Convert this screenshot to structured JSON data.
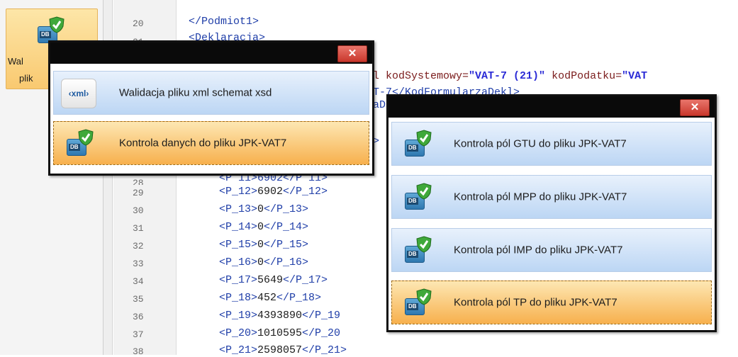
{
  "ribbon": {
    "button_line1": "Wal",
    "button_line2": "plik"
  },
  "editor": {
    "line_numbers": [
      "20",
      "21",
      "28",
      "29",
      "30",
      "31",
      "32",
      "33",
      "34",
      "35",
      "36",
      "37",
      "38"
    ],
    "lines": {
      "l20": "</Podmiot1>",
      "l21": "<Deklaracja>",
      "kod_attr": "l kodSystemowy=",
      "kod_val": "\"VAT-7 (21)\"",
      "kod_attr2": " kodPodatku=",
      "kod_val2": "\"VAT",
      "frag_a": "T-7</KodFormularzaDekl>",
      "frag_b": "aD",
      "frag_c": ">",
      "l28": "<P_11>6902</P_11>",
      "l29_open": "<P_12>",
      "l29_val": "6902",
      "l29_close": "</P_12>",
      "l30_open": "<P_13>",
      "l30_val": "0",
      "l30_close": "</P_13>",
      "l31_open": "<P_14>",
      "l31_val": "0",
      "l31_close": "</P_14>",
      "l32_open": "<P_15>",
      "l32_val": "0",
      "l32_close": "</P_15>",
      "l33_open": "<P_16>",
      "l33_val": "0",
      "l33_close": "</P_16>",
      "l34_open": "<P_17>",
      "l34_val": "5649",
      "l34_close": "</P_17>",
      "l35_open": "<P_18>",
      "l35_val": "452",
      "l35_close": "</P_18>",
      "l36_open": "<P_19>",
      "l36_val": "4393890",
      "l36_close": "</P_19",
      "l37_open": "<P_20>",
      "l37_val": "1010595",
      "l37_close": "</P_20",
      "l38_open": "<P_21>",
      "l38_val": "2598057",
      "l38_close": "</P_21>"
    }
  },
  "popup1": {
    "close_label": "✕",
    "items": [
      {
        "label": "Walidacja pliku xml schemat xsd",
        "icon": "xml-icon",
        "xml_text": "‹xml›"
      },
      {
        "label": "Kontrola danych do pliku JPK-VAT7",
        "icon": "db-check-icon",
        "db_text": "DB"
      }
    ]
  },
  "popup2": {
    "close_label": "✕",
    "items": [
      {
        "label": "Kontrola pól GTU do pliku JPK-VAT7",
        "icon": "db-check-icon",
        "db_text": "DB"
      },
      {
        "label": "Kontrola pól MPP do pliku JPK-VAT7",
        "icon": "db-check-icon",
        "db_text": "DB"
      },
      {
        "label": "Kontrola pól IMP do pliku JPK-VAT7",
        "icon": "db-check-icon",
        "db_text": "DB"
      },
      {
        "label": "Kontrola pól TP  do pliku JPK-VAT7",
        "icon": "db-check-icon",
        "db_text": "DB"
      }
    ]
  },
  "colors": {
    "selected_item": "#f7b04d",
    "normal_item": "#bcd6f4",
    "titlebar": "#0a0a0a",
    "close_button": "#c9372c"
  }
}
